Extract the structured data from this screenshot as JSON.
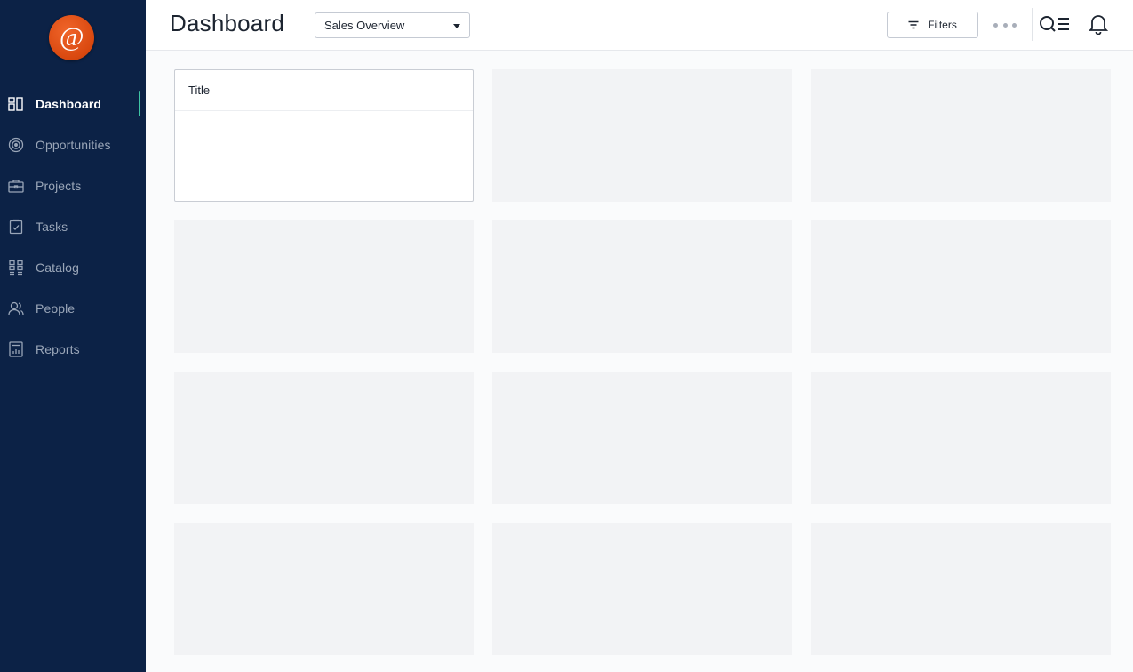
{
  "app": {
    "logo_glyph": "@",
    "accent_color": "#3fc4a4",
    "sidebar_bg": "#0c2246",
    "logo_color": "#e0520f"
  },
  "sidebar": {
    "items": [
      {
        "label": "Dashboard",
        "icon": "dashboard-icon",
        "active": true
      },
      {
        "label": "Opportunities",
        "icon": "target-icon",
        "active": false
      },
      {
        "label": "Projects",
        "icon": "briefcase-icon",
        "active": false
      },
      {
        "label": "Tasks",
        "icon": "clipboard-check-icon",
        "active": false
      },
      {
        "label": "Catalog",
        "icon": "grid-icon",
        "active": false
      },
      {
        "label": "People",
        "icon": "people-icon",
        "active": false
      },
      {
        "label": "Reports",
        "icon": "report-icon",
        "active": false
      }
    ]
  },
  "header": {
    "title": "Dashboard",
    "view_select": {
      "value": "Sales Overview"
    },
    "filters_label": "Filters",
    "icons": [
      "filter-icon",
      "more-icon",
      "search-menu-icon",
      "bell-icon"
    ]
  },
  "main": {
    "cards": [
      {
        "title": "Title"
      }
    ]
  }
}
